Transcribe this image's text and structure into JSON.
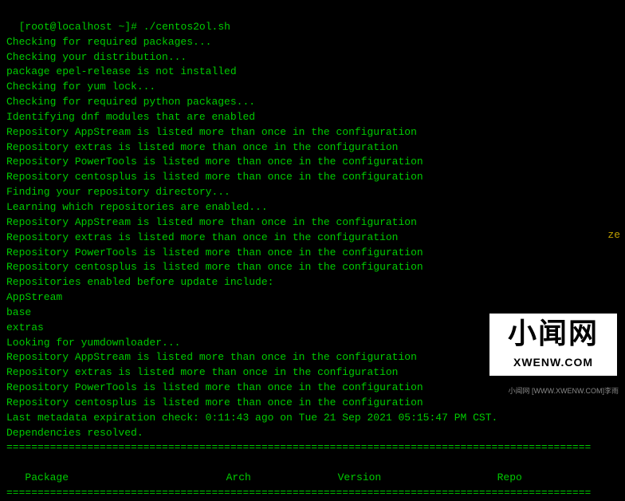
{
  "prompt": {
    "open": "[",
    "user": "root",
    "at": "@",
    "host": "localhost",
    "space": " ",
    "path": "~",
    "close": "]",
    "hash": "#",
    "command": " ./centos2ol.sh"
  },
  "lines": [
    "Checking for required packages...",
    "Checking your distribution...",
    "package epel-release is not installed",
    "Checking for yum lock...",
    "Checking for required python packages...",
    "Identifying dnf modules that are enabled",
    "Repository AppStream is listed more than once in the configuration",
    "Repository extras is listed more than once in the configuration",
    "Repository PowerTools is listed more than once in the configuration",
    "Repository centosplus is listed more than once in the configuration",
    "Finding your repository directory...",
    "Learning which repositories are enabled...",
    "Repository AppStream is listed more than once in the configuration",
    "Repository extras is listed more than once in the configuration",
    "Repository PowerTools is listed more than once in the configuration",
    "Repository centosplus is listed more than once in the configuration",
    "Repositories enabled before update include:",
    "AppStream",
    "base",
    "extras",
    "Looking for yumdownloader...",
    "Repository AppStream is listed more than once in the configuration",
    "Repository extras is listed more than once in the configuration",
    "Repository PowerTools is listed more than once in the configuration",
    "Repository centosplus is listed more than once in the configuration",
    "Last metadata expiration check: 0:11:43 ago on Tue 21 Sep 2021 05:15:47 PM CST.",
    "Dependencies resolved."
  ],
  "separator": "==============================================================================================",
  "headers": {
    "package": " Package",
    "arch": "Arch",
    "version": "Version",
    "repo": "Repo"
  },
  "watermark": {
    "big": "小闻网",
    "small": "XWENW.COM"
  },
  "bottom_tag": "小闻网 [WWW.XWENW.COM]李雨",
  "ze_fragment": "ze"
}
